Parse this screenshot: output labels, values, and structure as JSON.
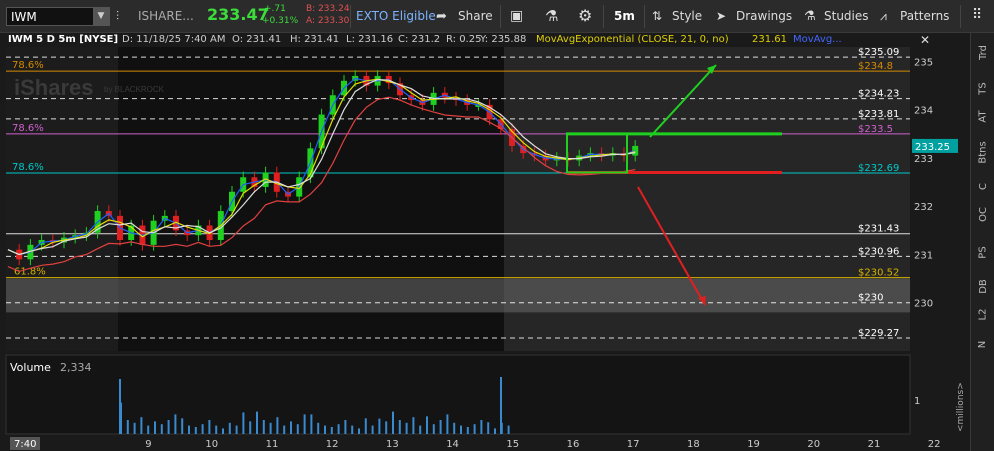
{
  "toolbar": {
    "symbol": "IWM",
    "product": "ISHARE...",
    "last": "233.47",
    "change": "+.71",
    "change_pct": "+0.31%",
    "bid": "B: 233.24",
    "ask": "A: 233.30",
    "exto": "EXTO Eligible",
    "share": "Share",
    "timeframe": "5m",
    "style": "Style",
    "drawings": "Drawings",
    "studies": "Studies",
    "patterns": "Patterns"
  },
  "info": {
    "title": "IWM 5 D 5m [NYSE]",
    "date": "D: 11/18/25 7:40 AM",
    "open": "O: 231.41",
    "high": "H: 231.41",
    "low": "L: 231.16",
    "close": "C: 231.2",
    "range": "R: 0.25",
    "y": "Y: 235.88",
    "study": "MovAvgExponential (CLOSE, 21, 0, no)",
    "study_val": "231.61",
    "study2": "MovAvg..."
  },
  "right_tabs": [
    "Trd",
    "TS",
    "AT",
    "Btns",
    "C",
    "OC",
    "PS",
    "DB",
    "L2",
    "N"
  ],
  "watermark": {
    "brand": "iShares",
    "sub": "by BLACKROCK"
  },
  "volume": {
    "label": "Volume",
    "value": "2,334",
    "scale_label": "<millions>",
    "ticks": [
      "1"
    ]
  },
  "colors": {
    "accent_green": "#00c000",
    "accent_red": "#e00000",
    "fib": "#d48a00",
    "magenta": "#d060d0",
    "cyan": "#00c8c8"
  },
  "chart_data": {
    "type": "candlestick",
    "symbol": "IWM",
    "interval": "5m",
    "period": "5 D",
    "x_labels": [
      "7:40",
      "9",
      "10",
      "11",
      "12",
      "13",
      "14",
      "15",
      "16",
      "17",
      "18",
      "19",
      "20",
      "21",
      "22"
    ],
    "y_ticks": [
      235,
      234,
      233,
      232,
      231,
      230
    ],
    "ylim": [
      229.0,
      235.3
    ],
    "last_price": "233.25",
    "price_levels": [
      {
        "label": "$235.09",
        "value": 235.09,
        "color": "#ffffff",
        "style": "dashed"
      },
      {
        "label": "$234.8",
        "value": 234.8,
        "color": "#d48a00",
        "style": "solid",
        "fib": "78.6%"
      },
      {
        "label": "$234.23",
        "value": 234.23,
        "color": "#ffffff",
        "style": "dashed"
      },
      {
        "label": "$233.81",
        "value": 233.81,
        "color": "#ffffff",
        "style": "dashed"
      },
      {
        "label": "$233.5",
        "value": 233.5,
        "color": "#d060d0",
        "style": "solid",
        "fib": "78.6%"
      },
      {
        "label": "$232.69",
        "value": 232.69,
        "color": "#00c8c8",
        "style": "solid",
        "fib": "78.6%"
      },
      {
        "label": "$231.43",
        "value": 231.43,
        "color": "#ffffff",
        "style": "solid"
      },
      {
        "label": "$230.96",
        "value": 230.96,
        "color": "#ffffff",
        "style": "dashed"
      },
      {
        "label": "$230.52",
        "value": 230.52,
        "color": "#d4b000",
        "style": "solid",
        "fib": "61.8%"
      },
      {
        "label": "$230",
        "value": 230.0,
        "color": "#ffffff",
        "style": "dashed"
      },
      {
        "label": "$229.27",
        "value": 229.27,
        "color": "#ffffff",
        "style": "dashed"
      }
    ],
    "series": [
      {
        "name": "IWM",
        "points": [
          [
            0,
            231.1
          ],
          [
            0.2,
            230.9
          ],
          [
            0.4,
            231.2
          ],
          [
            0.6,
            231.3
          ],
          [
            0.8,
            231.25
          ],
          [
            1.0,
            231.35
          ],
          [
            1.2,
            231.4
          ],
          [
            1.4,
            231.45
          ],
          [
            1.6,
            231.9
          ],
          [
            1.8,
            231.8
          ],
          [
            2.0,
            231.3
          ],
          [
            2.2,
            231.6
          ],
          [
            2.4,
            231.2
          ],
          [
            2.6,
            231.7
          ],
          [
            2.8,
            231.8
          ],
          [
            3.0,
            231.5
          ],
          [
            3.2,
            231.4
          ],
          [
            3.4,
            231.6
          ],
          [
            3.6,
            231.3
          ],
          [
            3.8,
            231.9
          ],
          [
            4.0,
            232.3
          ],
          [
            4.2,
            232.6
          ],
          [
            4.4,
            232.4
          ],
          [
            4.6,
            232.7
          ],
          [
            4.8,
            232.3
          ],
          [
            5.0,
            232.2
          ],
          [
            5.2,
            232.6
          ],
          [
            5.4,
            233.2
          ],
          [
            5.6,
            233.9
          ],
          [
            5.8,
            234.3
          ],
          [
            6.0,
            234.6
          ],
          [
            6.2,
            234.7
          ],
          [
            6.4,
            234.5
          ],
          [
            6.6,
            234.7
          ],
          [
            6.8,
            234.55
          ],
          [
            7.0,
            234.3
          ],
          [
            7.2,
            234.2
          ],
          [
            7.4,
            234.1
          ],
          [
            7.6,
            234.35
          ],
          [
            7.8,
            234.25
          ],
          [
            8.0,
            234.2
          ],
          [
            8.2,
            234.1
          ],
          [
            8.4,
            234.1
          ],
          [
            8.6,
            233.8
          ],
          [
            8.8,
            233.6
          ],
          [
            9.0,
            233.25
          ],
          [
            9.2,
            233.1
          ],
          [
            9.4,
            233.05
          ],
          [
            9.6,
            232.95
          ],
          [
            9.8,
            233.0
          ],
          [
            10.0,
            232.95
          ],
          [
            10.2,
            233.05
          ],
          [
            10.4,
            233.1
          ],
          [
            10.6,
            233.05
          ],
          [
            10.8,
            233.1
          ],
          [
            11.0,
            233.05
          ],
          [
            11.2,
            233.25
          ]
        ]
      }
    ],
    "ema_levels": [
      231.4,
      231.4,
      231.4,
      231.8,
      233.0,
      233.9,
      234.2,
      234.1,
      233.7,
      233.2,
      233.05
    ]
  }
}
